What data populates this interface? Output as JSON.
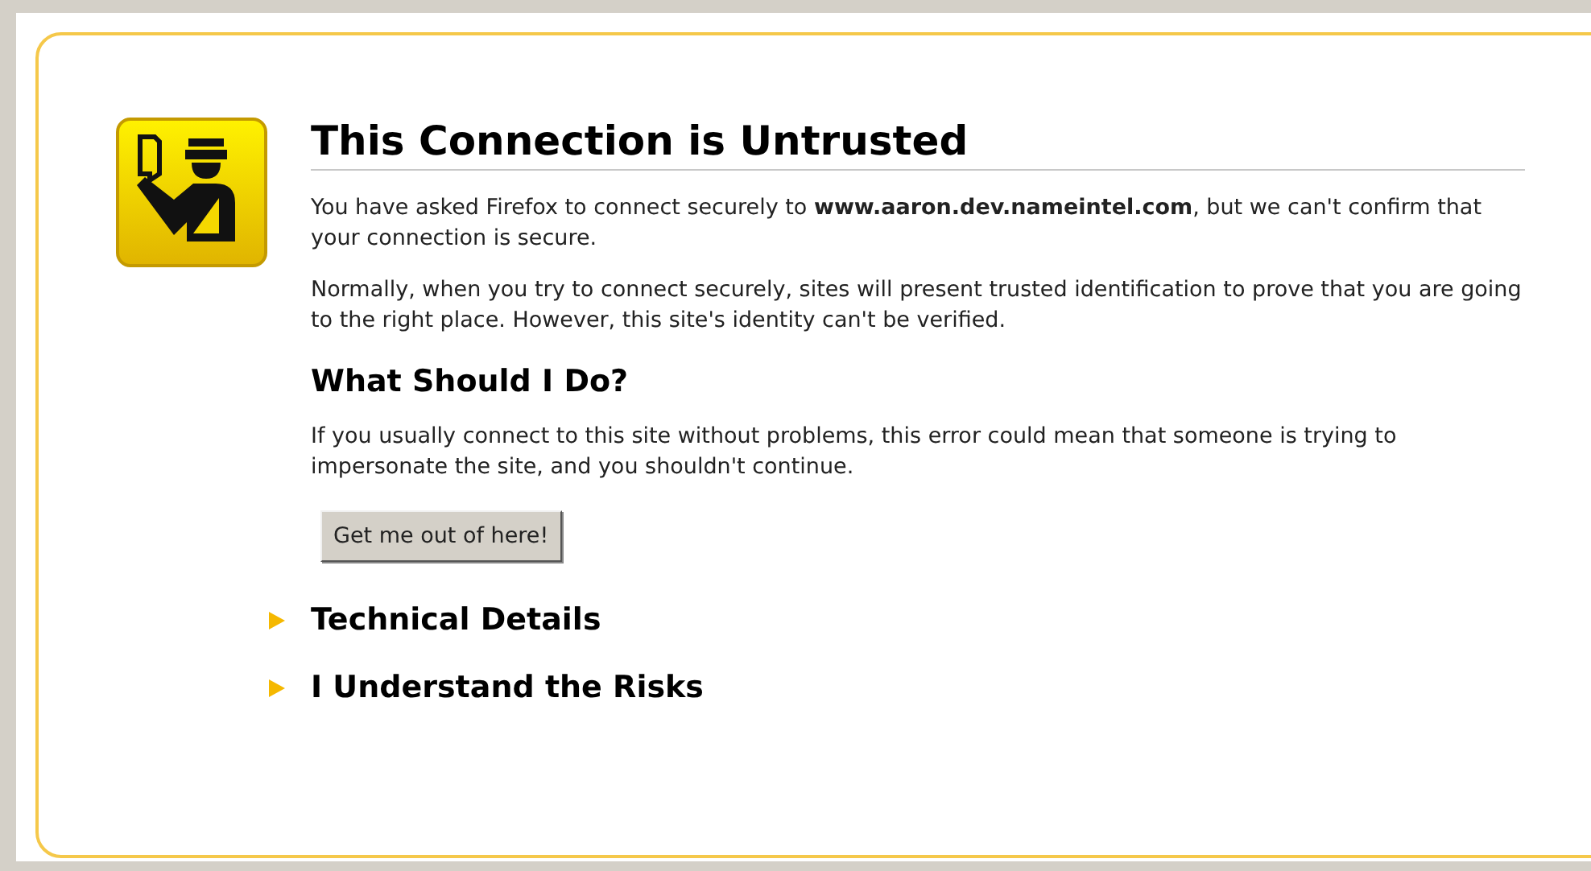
{
  "title": "This Connection is Untrusted",
  "paragraphs": [
    "You have asked Firefox to connect securely to **www.aaron.dev.nameintel.com**, but we can't confirm that your connection is secure.",
    "Normally, when you try to connect securely, sites will present trusted identification to prove that you are going to the right place. However, this site's identity can't be verified."
  ],
  "what_to_do": {
    "heading": "What Should I Do?",
    "text": "If you usually connect to this site without problems, this error could mean that someone is trying to impersonate the site, and you shouldn't continue.",
    "button": "Get me out of here!"
  },
  "sections": [
    {
      "label": "Technical Details",
      "expanded": false
    },
    {
      "label": "I Understand the Risks",
      "expanded": false
    }
  ]
}
